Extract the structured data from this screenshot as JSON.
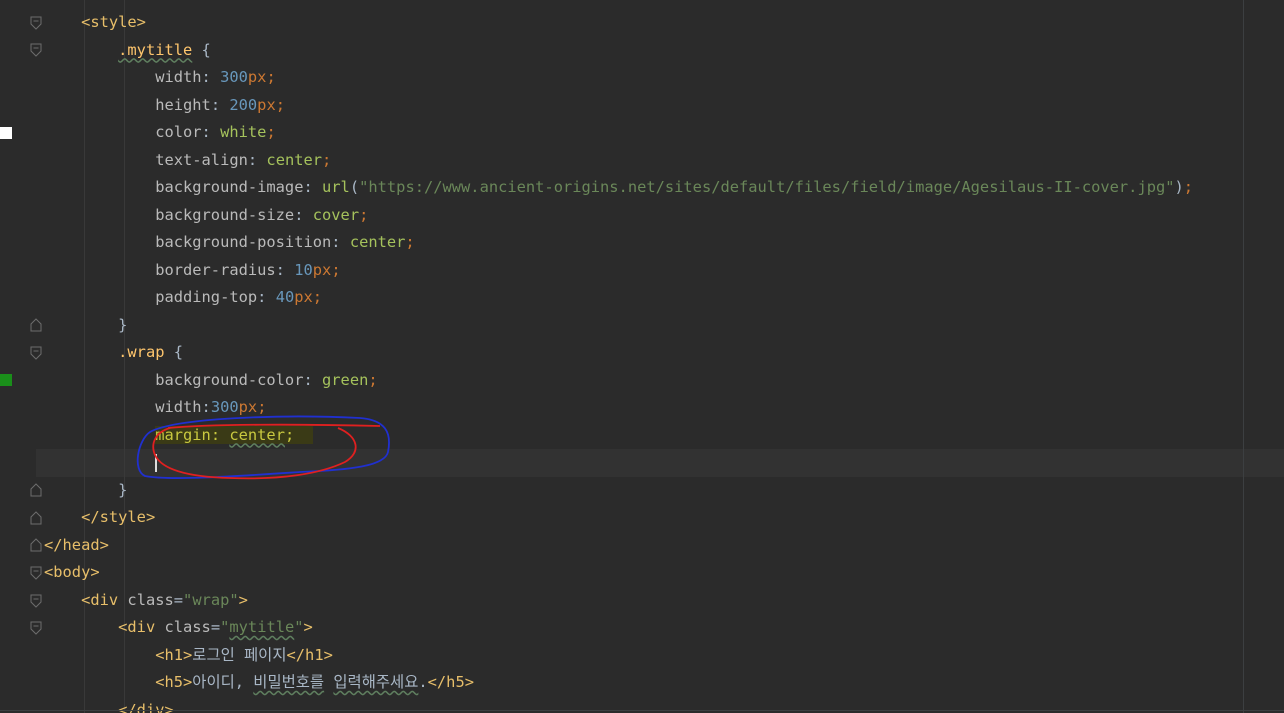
{
  "colors": {
    "background": "#2b2b2b",
    "tag": "#e8bf6a",
    "selector": "#ffc66d",
    "number": "#6897bb",
    "unit_keyword": "#cc7832",
    "css_value": "#a5c25c",
    "string": "#6a8759",
    "annotation_red": "#e02020",
    "annotation_blue": "#2030d0",
    "marker_white": "#ffffff",
    "marker_green": "#1a8f1a"
  },
  "code": {
    "l1": {
      "open": "<style>"
    },
    "l2": {
      "selector": ".mytitle",
      "rest": " {"
    },
    "l3": {
      "prop": "width",
      "num": "300",
      "unit": "px"
    },
    "l4": {
      "prop": "height",
      "num": "200",
      "unit": "px"
    },
    "l5": {
      "prop": "color",
      "value": "white"
    },
    "l6": {
      "prop": "text-align",
      "value": "center"
    },
    "l7": {
      "prop": "background-image",
      "fn": "url",
      "string": "\"https://www.ancient-origins.net/sites/default/files/field/image/Agesilaus-II-cover.jpg\""
    },
    "l8": {
      "prop": "background-size",
      "value": "cover"
    },
    "l9": {
      "prop": "background-position",
      "value": "center"
    },
    "l10": {
      "prop": "border-radius",
      "num": "10",
      "unit": "px"
    },
    "l11": {
      "prop": "padding-top",
      "num": "40",
      "unit": "px"
    },
    "l12": {
      "brace": "}"
    },
    "l13": {
      "selector": ".wrap",
      "rest": " {"
    },
    "l14": {
      "prop": "background-color",
      "value": "green"
    },
    "l15": {
      "prop": "width",
      "num": "300",
      "unit": "px"
    },
    "l16": {
      "prop": "margin",
      "value": "center"
    },
    "l18": {
      "brace": "}"
    },
    "l19": {
      "close": "</style>"
    },
    "l20": {
      "close": "</head>"
    },
    "l21": {
      "open": "<body>"
    },
    "l22": {
      "tag_open": "<div ",
      "attr": "class",
      "eq": "=",
      "value": "\"wrap\"",
      "end": ">"
    },
    "l23": {
      "tag_open": "<div ",
      "attr": "class",
      "eq": "=",
      "q1": "\"",
      "value": "mytitle",
      "q2": "\"",
      "end": ">"
    },
    "l24": {
      "open": "<h1>",
      "text": "로그인 페이지",
      "close": "</h1>"
    },
    "l25": {
      "open": "<h5>",
      "text_a": "아이디, ",
      "text_b": "비밀번호를",
      "text_c": " ",
      "text_d": "입력해주세요",
      "text_e": ".",
      "close": "</h5>"
    },
    "l26": {
      "partial": "</div>"
    }
  }
}
